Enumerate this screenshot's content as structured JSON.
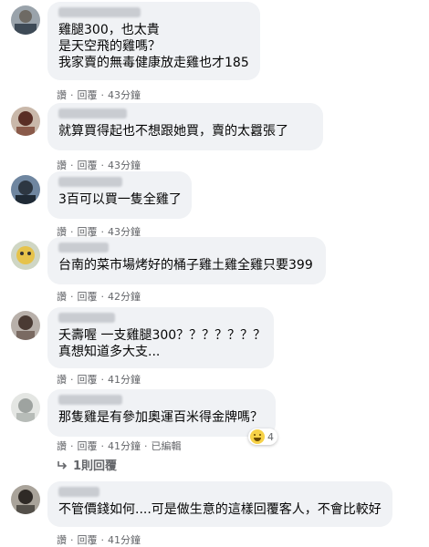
{
  "colors": {
    "bubble": "#f0f2f5",
    "meta": "#65676b",
    "text": "#050505"
  },
  "comments": [
    {
      "lines": [
        "雞腿300，也太貴",
        "是天空飛的雞嗎？",
        "我家賣的無毒健康放走雞也才185"
      ],
      "like": "讚",
      "reply": "回覆",
      "time": "43分鐘"
    },
    {
      "lines": [
        "就算買得起也不想跟她買，賣的太囂張了"
      ],
      "like": "讚",
      "reply": "回覆",
      "time": "43分鐘"
    },
    {
      "lines": [
        "3百可以買一隻全雞了"
      ],
      "like": "讚",
      "reply": "回覆",
      "time": "43分鐘"
    },
    {
      "lines": [
        "台南的菜市場烤好的桶子雞土雞全雞只要399"
      ],
      "like": "讚",
      "reply": "回覆",
      "time": "42分鐘"
    },
    {
      "lines": [
        "夭壽喔 一支雞腿300？？？？？？？",
        "真想知道多大支..."
      ],
      "like": "讚",
      "reply": "回覆",
      "time": "41分鐘"
    },
    {
      "lines": [
        "那隻雞是有參加奧運百米得金牌嗎？"
      ],
      "like": "讚",
      "reply": "回覆",
      "time": "41分鐘",
      "edited": "已編輯",
      "reaction_count": "4",
      "reaction_icon": "haha-emoji-icon"
    },
    {
      "lines": [
        "不管價錢如何....可是做生意的這樣回覆客人，不會比較好"
      ],
      "like": "讚",
      "reply": "回覆",
      "time": "41分鐘"
    }
  ],
  "replies_link": "1則回覆"
}
